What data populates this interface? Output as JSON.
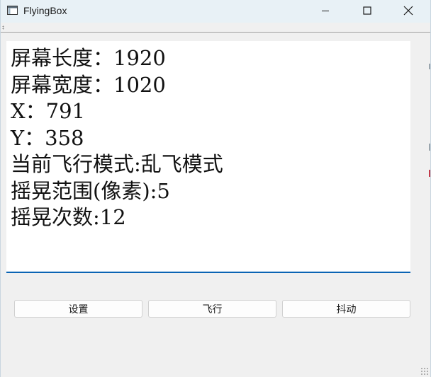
{
  "window": {
    "title": "FlyingBox",
    "icon": "window-app-icon",
    "controls": [
      "minimize-icon",
      "maximize-icon",
      "close-icon"
    ]
  },
  "info_lines": [
    "屏幕长度：1920",
    "屏幕宽度：1020",
    "X：791",
    "Y：358",
    "当前飞行模式:乱飞模式",
    "摇晃范围(像素):5",
    "摇晃次数:12"
  ],
  "buttons": {
    "settings": "设置",
    "fly": "飞行",
    "shake": "抖动"
  },
  "colors": {
    "titlebar": "#e8f1f6",
    "window_bg": "#f0f0f0",
    "focus_underline": "#0a64b4"
  }
}
